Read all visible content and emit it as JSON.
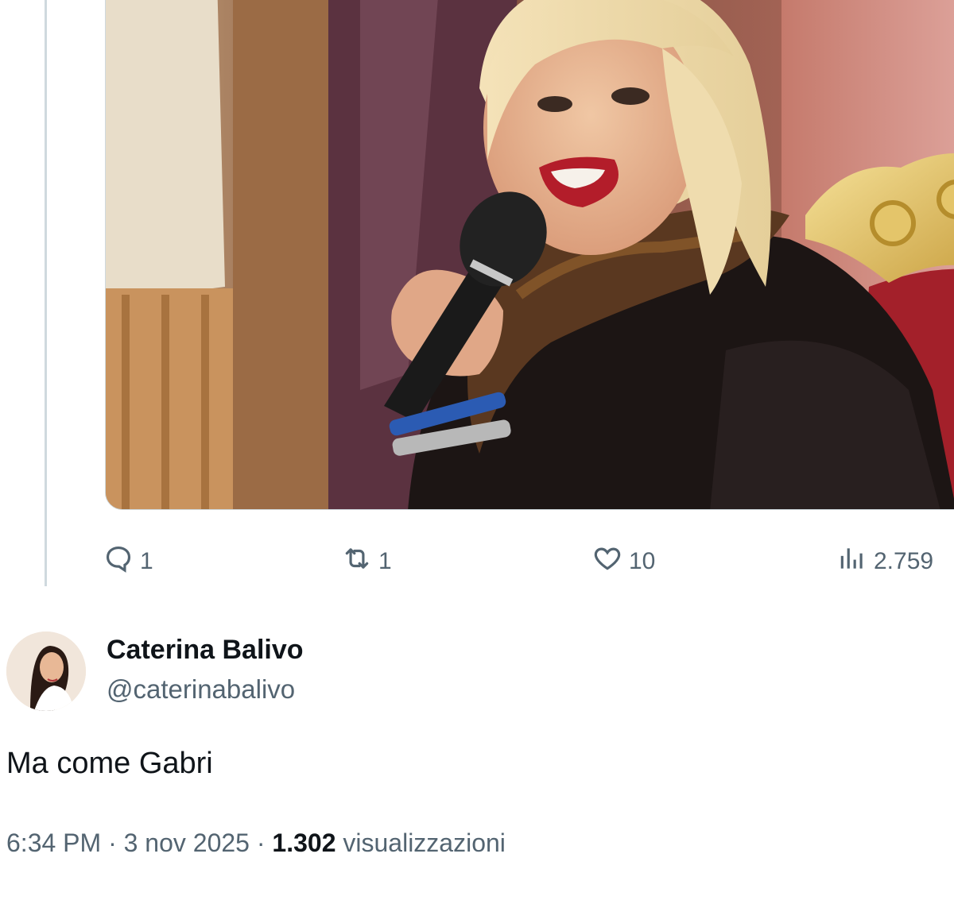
{
  "tweet": {
    "media": {
      "description_icon": "photo"
    },
    "actions": {
      "reply": {
        "icon": "reply-icon",
        "count": "1"
      },
      "retweet": {
        "icon": "retweet-icon",
        "count": "1"
      },
      "like": {
        "icon": "heart-icon",
        "count": "10"
      },
      "views": {
        "icon": "views-icon",
        "count": "2.759"
      }
    }
  },
  "quote": {
    "author": {
      "name": "Caterina Balivo",
      "handle": "@caterinabalivo"
    },
    "text": "Ma come Gabri",
    "meta": {
      "time": "6:34 PM",
      "separator": "·",
      "date": "3 nov 2025",
      "views_count": "1.302",
      "views_label": "visualizzazioni"
    }
  },
  "colors": {
    "secondary_text": "#536471",
    "primary_text": "#0f1419",
    "border": "#cfd9de"
  }
}
